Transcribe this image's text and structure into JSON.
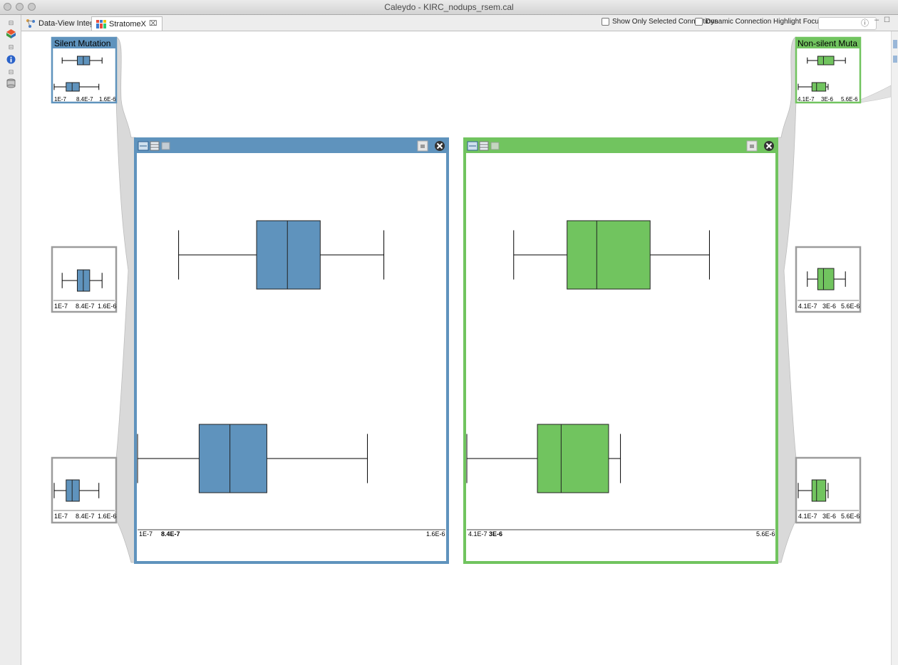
{
  "window": {
    "title": "Caleydo - KIRC_nodups_rsem.cal"
  },
  "tabs": [
    {
      "label": "Data-View Integrator",
      "icon": "data-view-integrator-icon",
      "active": false
    },
    {
      "label": "StratomeX",
      "icon": "stratomex-icon",
      "active": true
    }
  ],
  "toolbar": {
    "show_only_selected": "Show Only Selected Connections",
    "dynamic_highlight": "Dynamic Connection Highlight Focus"
  },
  "colors": {
    "blue": "#5f93bd",
    "green": "#71c45f",
    "frame_gray": "#9c9c9c",
    "ribbon": "#d8d8d8"
  },
  "columns": [
    {
      "header": "Silent Mutation",
      "color": "blue",
      "axis_labels": [
        "1E-7",
        "8.4E-7",
        "1.6E-6"
      ],
      "main_axis_left": "1E-7",
      "main_axis_overlap": "8.4E-7",
      "main_axis_right": "1.6E-6",
      "boxplots": [
        {
          "min": 3e-07,
          "q1": 6.8e-07,
          "median": 8.3e-07,
          "q3": 9.9e-07,
          "max": 1.3e-06
        },
        {
          "min": 1e-07,
          "q1": 4e-07,
          "median": 5.5e-07,
          "q3": 7.3e-07,
          "max": 1.22e-06
        }
      ]
    },
    {
      "header": "Non-silent Muta",
      "color": "green",
      "axis_labels": [
        "4.1E-7",
        "3E-6",
        "5.6E-6"
      ],
      "main_axis_left": "4.1E-7",
      "main_axis_overlap": "3E-6",
      "main_axis_right": "5.6E-6",
      "boxplots": [
        {
          "min": 1.2e-06,
          "q1": 2.1e-06,
          "median": 2.6e-06,
          "q3": 3.5e-06,
          "max": 4.5e-06
        },
        {
          "min": 4.1e-07,
          "q1": 1.6e-06,
          "median": 2e-06,
          "q3": 2.8e-06,
          "max": 3e-06
        }
      ]
    }
  ]
}
